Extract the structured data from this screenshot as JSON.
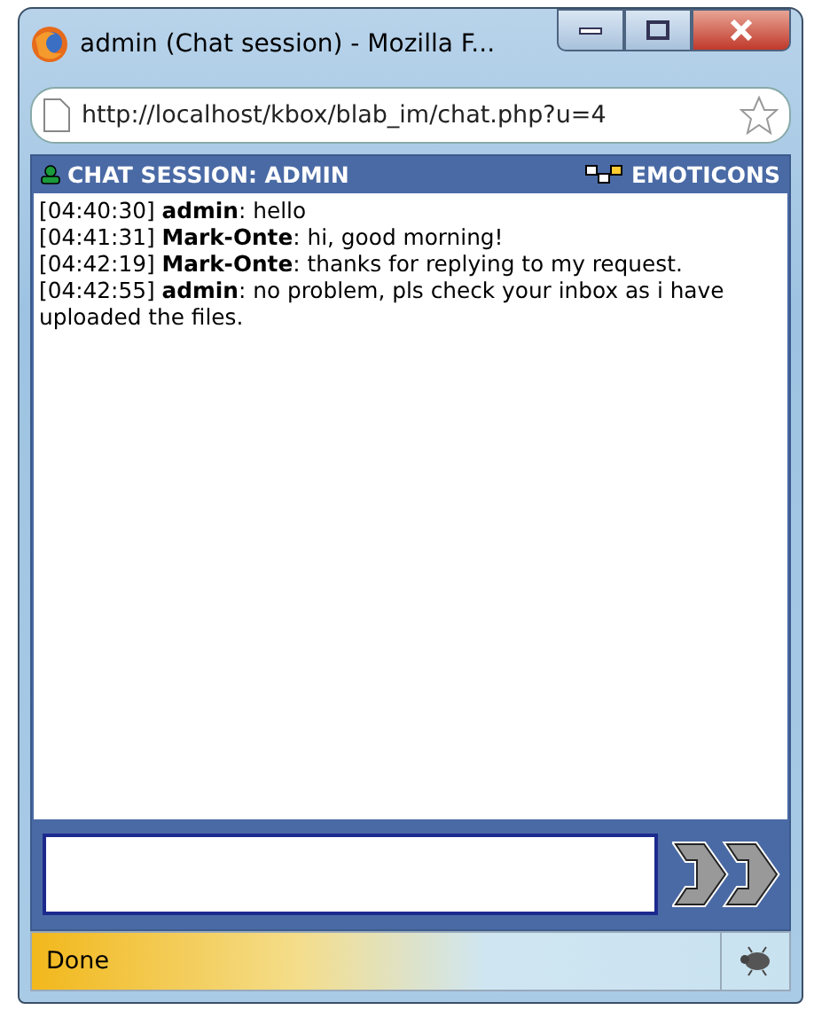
{
  "window": {
    "title": "admin (Chat session) - Mozilla F..."
  },
  "address_bar": {
    "url": "http://localhost/kbox/blab_im/chat.php?u=4"
  },
  "header": {
    "session": "CHAT SESSION: ADMIN",
    "emoticons": "EMOTICONS"
  },
  "messages": [
    {
      "text": "[04:40:30] **admin**: hello"
    },
    {
      "text": "[04:41:31] **Mark-Onte**: hi, good morning!"
    },
    {
      "text": "[04:42:19] **Mark-Onte**: thanks for replying to my request."
    },
    {
      "text": "[04:42:55] **admin**: no problem, pls check your inbox as i have uploaded the files."
    }
  ],
  "status_bar": {
    "text": "Done"
  }
}
